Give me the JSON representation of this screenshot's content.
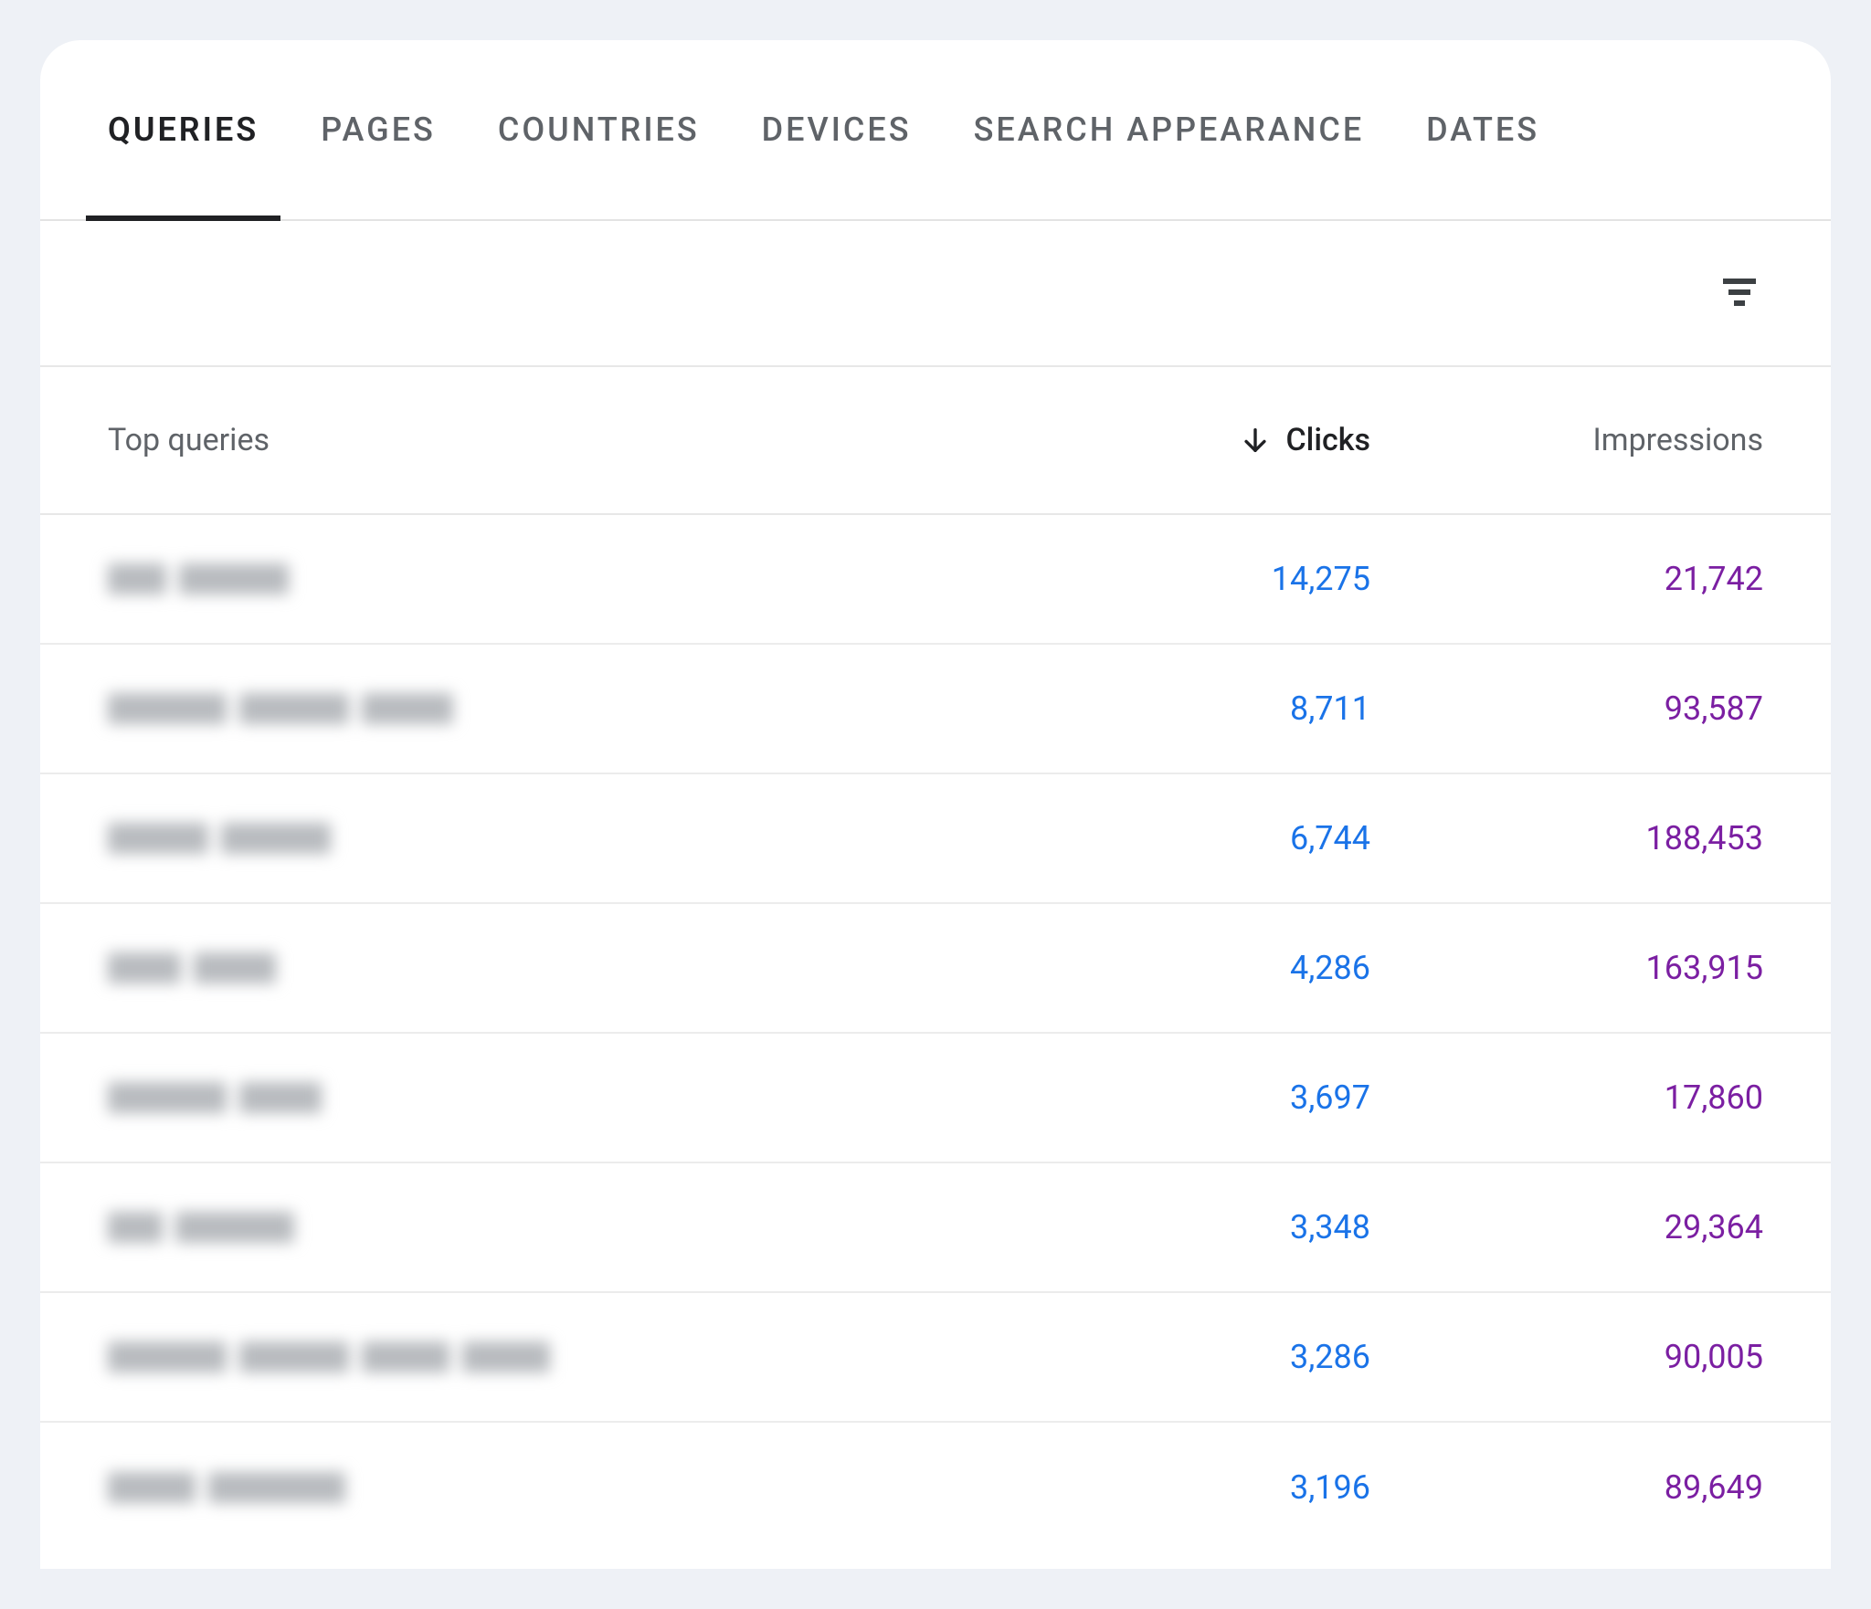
{
  "tabs": [
    {
      "label": "QUERIES",
      "active": true
    },
    {
      "label": "PAGES",
      "active": false
    },
    {
      "label": "COUNTRIES",
      "active": false
    },
    {
      "label": "DEVICES",
      "active": false
    },
    {
      "label": "SEARCH APPEARANCE",
      "active": false
    },
    {
      "label": "DATES",
      "active": false
    }
  ],
  "table": {
    "headers": {
      "query": "Top queries",
      "clicks": "Clicks",
      "impressions": "Impressions"
    },
    "sort": {
      "column": "clicks",
      "direction": "desc"
    },
    "rows": [
      {
        "query_redacted": true,
        "blur_widths": [
          64,
          120
        ],
        "clicks": "14,275",
        "impressions": "21,742"
      },
      {
        "query_redacted": true,
        "blur_widths": [
          130,
          120,
          100
        ],
        "clicks": "8,711",
        "impressions": "93,587"
      },
      {
        "query_redacted": true,
        "blur_widths": [
          110,
          120
        ],
        "clicks": "6,744",
        "impressions": "188,453"
      },
      {
        "query_redacted": true,
        "blur_widths": [
          80,
          90
        ],
        "clicks": "4,286",
        "impressions": "163,915"
      },
      {
        "query_redacted": true,
        "blur_widths": [
          130,
          90
        ],
        "clicks": "3,697",
        "impressions": "17,860"
      },
      {
        "query_redacted": true,
        "blur_widths": [
          60,
          130
        ],
        "clicks": "3,348",
        "impressions": "29,364"
      },
      {
        "query_redacted": true,
        "blur_widths": [
          130,
          120,
          96,
          96
        ],
        "clicks": "3,286",
        "impressions": "90,005"
      },
      {
        "query_redacted": true,
        "blur_widths": [
          96,
          150
        ],
        "clicks": "3,196",
        "impressions": "89,649"
      }
    ]
  },
  "colors": {
    "clicks": "#1a73e8",
    "impressions": "#7b1fa2",
    "text_primary": "#202124",
    "text_secondary": "#5f6368"
  }
}
